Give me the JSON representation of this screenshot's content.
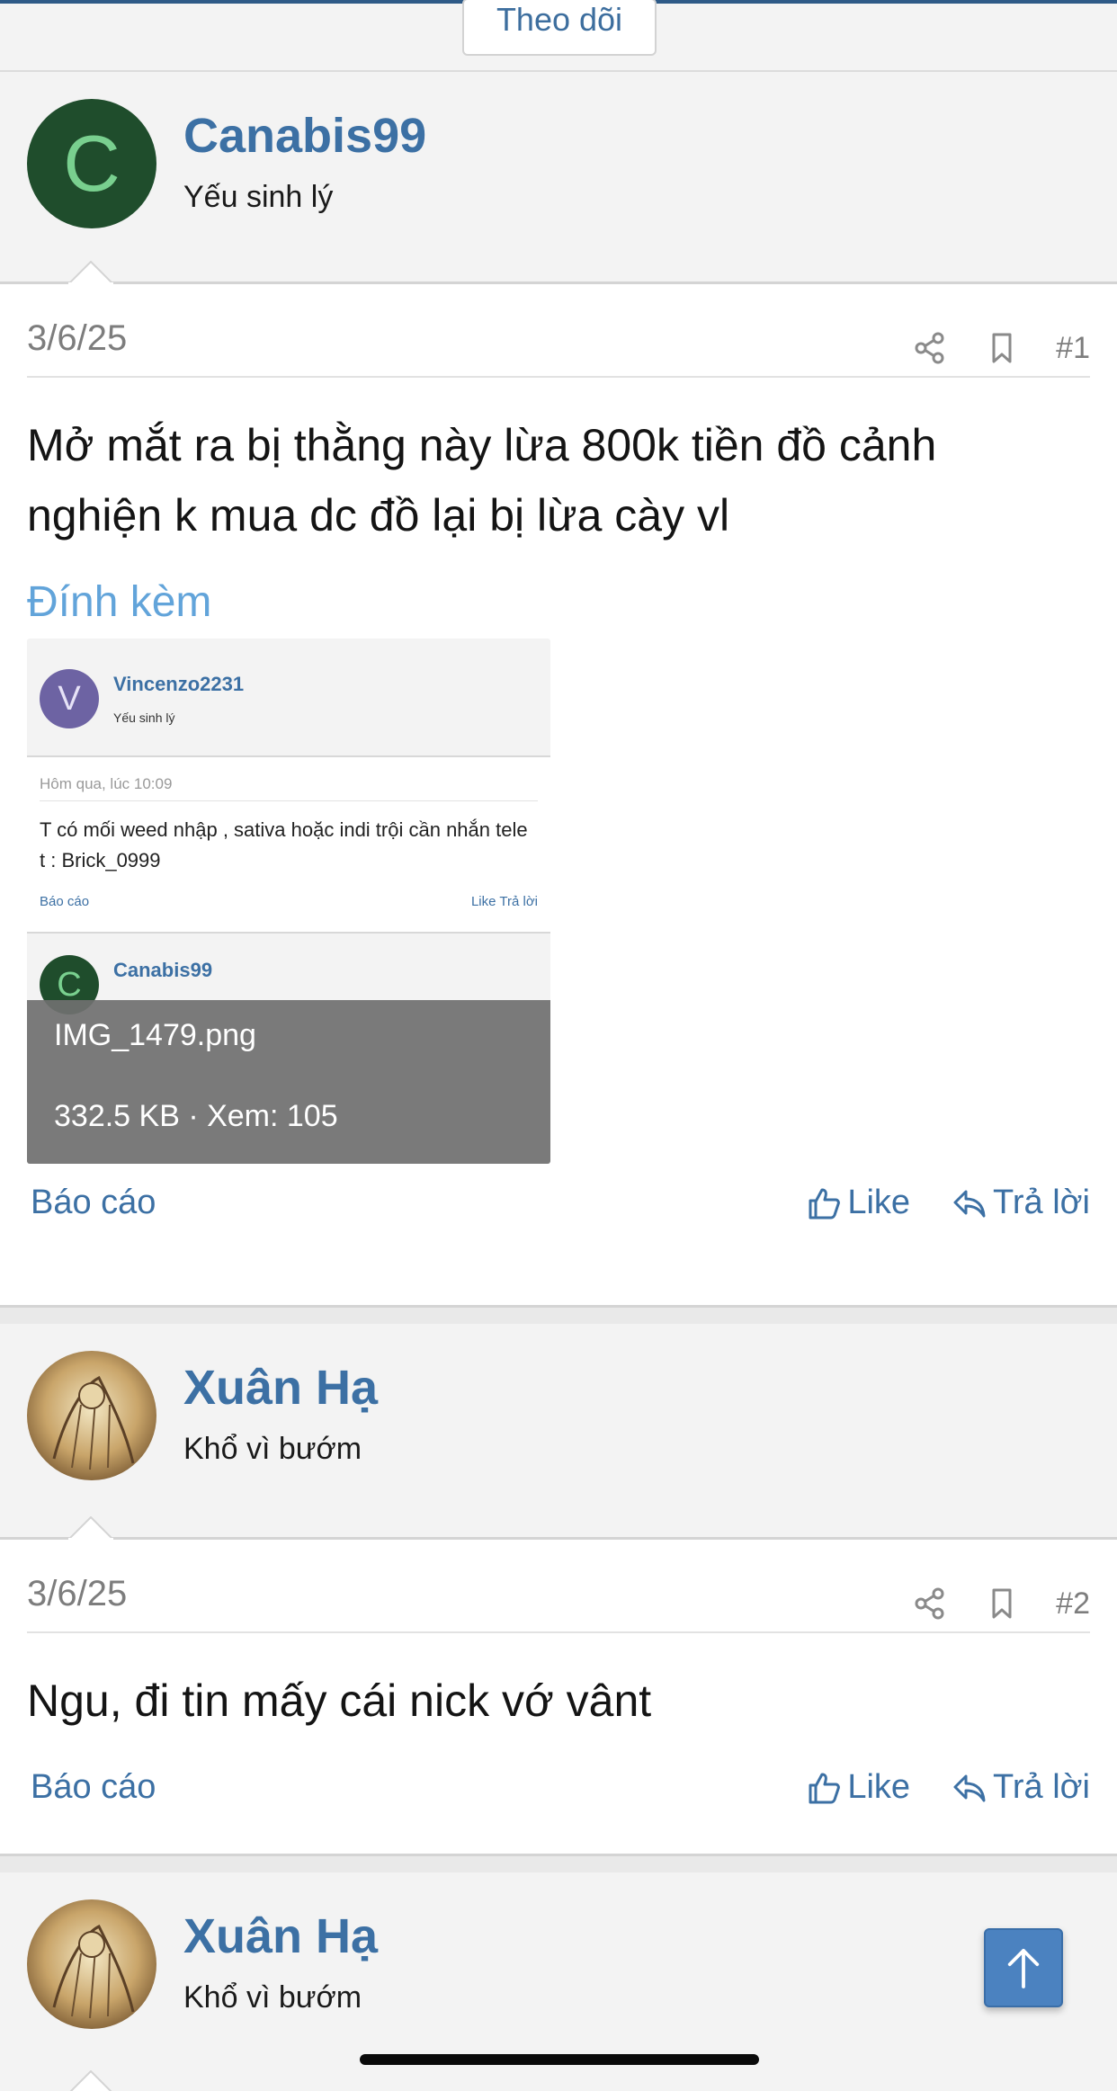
{
  "follow_button": {
    "label": "Theo dõi"
  },
  "posts": [
    {
      "author": {
        "avatar_letter": "C",
        "name": "Canabis99",
        "title": "Yếu sinh lý"
      },
      "date": "3/6/25",
      "number": "#1",
      "body": "Mở mắt ra bị thằng này lừa 800k tiền đồ cảnh nghiện k mua dc đồ lại bị lừa cày vl",
      "attachments_label": "Đính kèm",
      "attachment": {
        "filename": "IMG_1479.png",
        "meta": "332.5 KB · Xem: 105",
        "preview": {
          "avatar_letter": "V",
          "name": "Vincenzo2231",
          "title": "Yếu sinh lý",
          "date": "Hôm qua, lúc 10:09",
          "body": "T có mối weed nhập , sativa hoặc indi trội cần nhắn tele t : Brick_0999",
          "report": "Báo cáo",
          "actions": "Like   Trả lời",
          "next_avatar_letter": "C",
          "next_name": "Canabis99"
        }
      },
      "report_label": "Báo cáo",
      "like_label": "Like",
      "reply_label": "Trả lời"
    },
    {
      "author": {
        "name": "Xuân Hạ",
        "title": "Khổ vì bướm"
      },
      "date": "3/6/25",
      "number": "#2",
      "body": "Ngu, đi tin mấy cái nick vớ vânt",
      "report_label": "Báo cáo",
      "like_label": "Like",
      "reply_label": "Trả lời"
    },
    {
      "author": {
        "name": "Xuân Hạ",
        "title": "Khổ vì bướm"
      }
    }
  ],
  "icons": {
    "share": "share-icon",
    "bookmark": "bookmark-icon",
    "like": "thumbs-up-icon",
    "reply": "reply-arrow-icon",
    "scroll_top": "arrow-up-icon"
  },
  "colors": {
    "link": "#3c70a4",
    "attachment_label": "#62a4da",
    "scroll_button": "#4b82c0"
  }
}
